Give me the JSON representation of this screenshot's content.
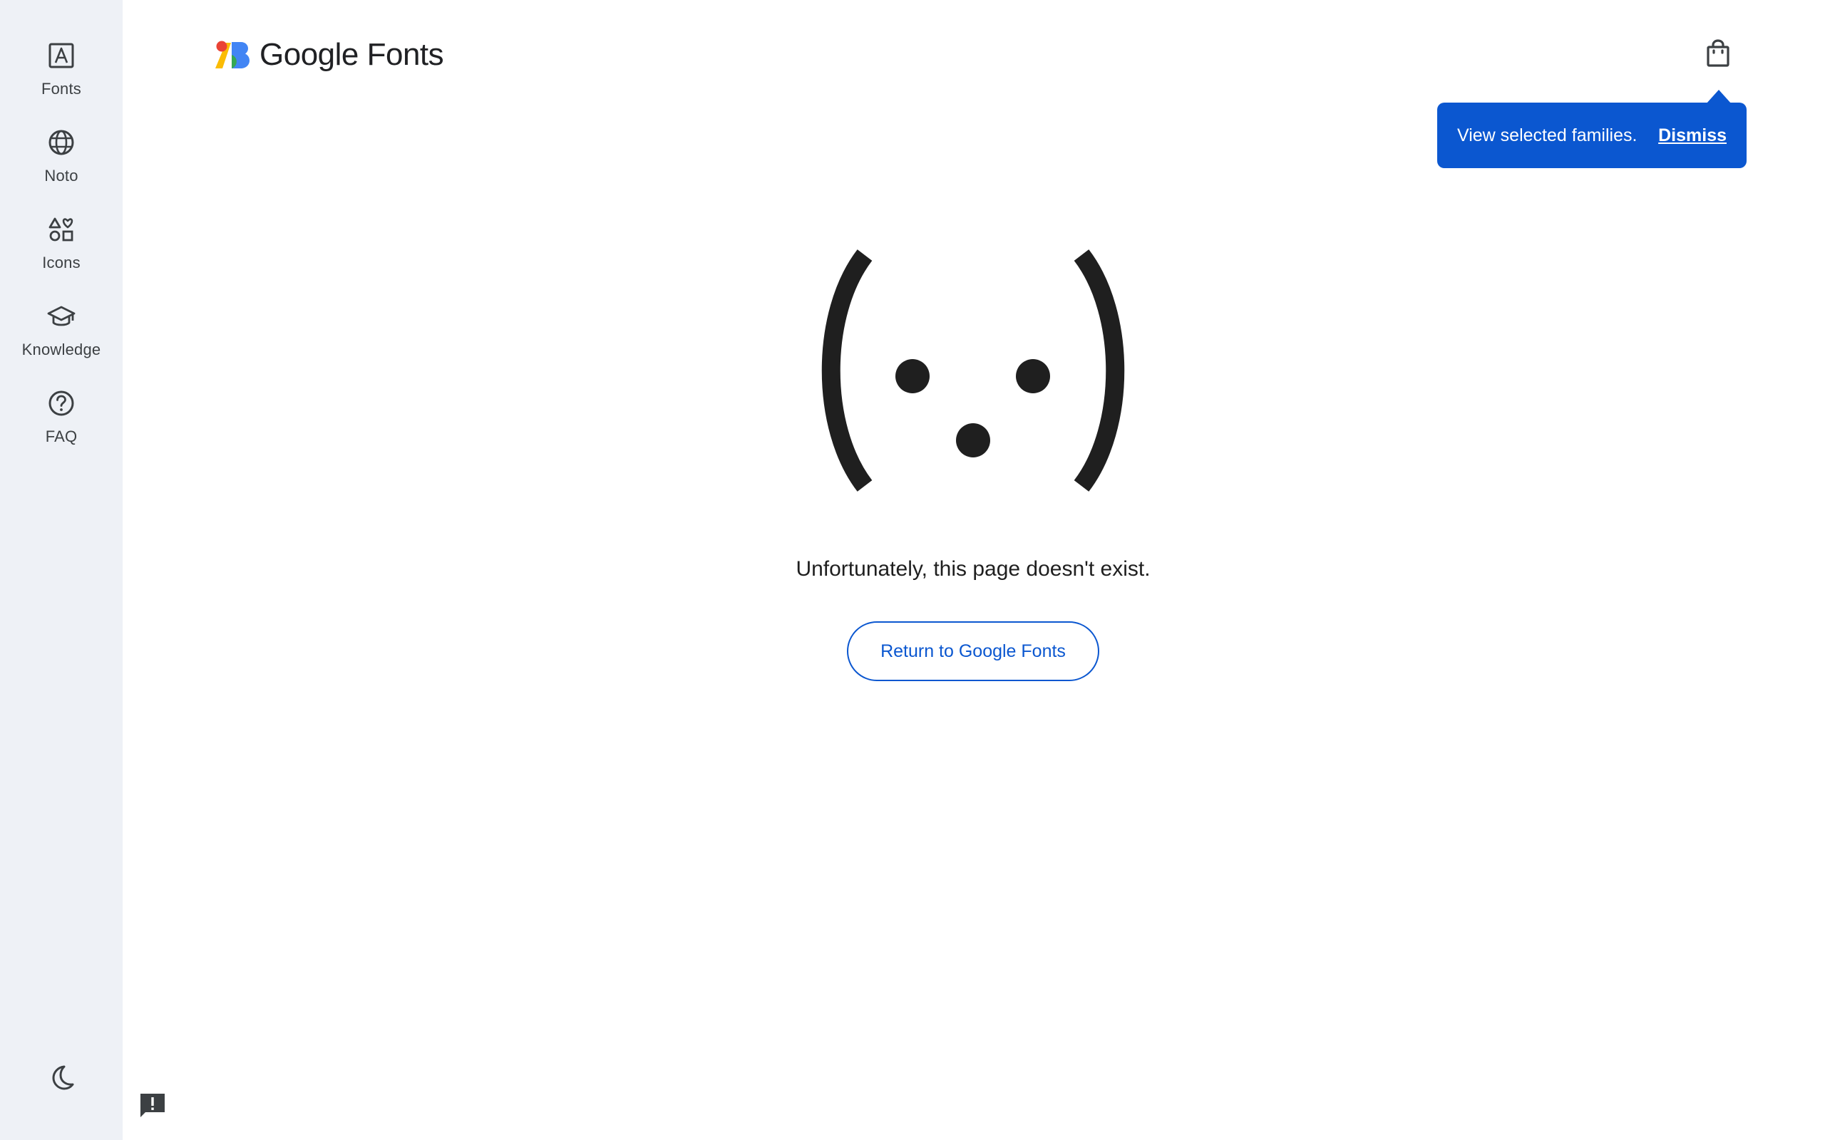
{
  "brand": {
    "logo_text": "Google Fonts"
  },
  "sidebar": {
    "items": [
      {
        "label": "Fonts",
        "icon": "text-box-icon"
      },
      {
        "label": "Noto",
        "icon": "globe-icon"
      },
      {
        "label": "Icons",
        "icon": "shapes-icon"
      },
      {
        "label": "Knowledge",
        "icon": "school-icon"
      },
      {
        "label": "FAQ",
        "icon": "help-circle-icon"
      }
    ],
    "theme_icon": "moon-icon",
    "feedback_icon": "feedback-icon"
  },
  "header": {
    "cart_icon": "shopping-bag-icon"
  },
  "tooltip": {
    "text": "View selected families.",
    "dismiss_label": "Dismiss"
  },
  "error": {
    "message": "Unfortunately, this page doesn't exist.",
    "return_label": "Return to Google Fonts"
  },
  "colors": {
    "accent": "#0b57d0",
    "rail_background": "#eef1f6",
    "text": "#1f1f1f"
  }
}
